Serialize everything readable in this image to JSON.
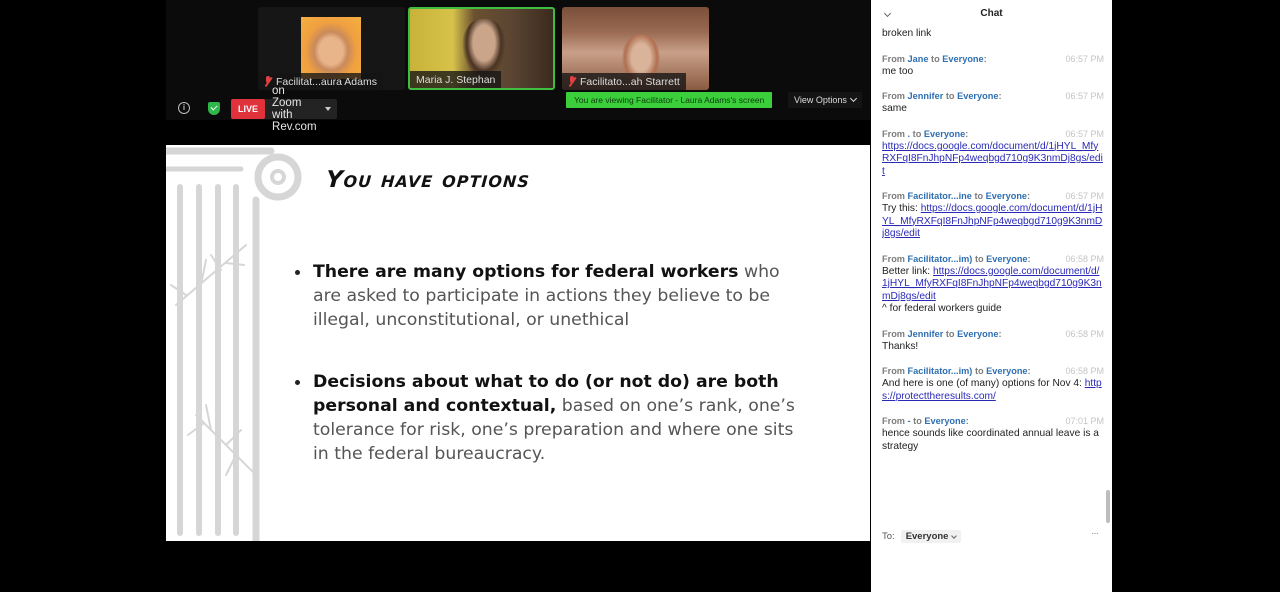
{
  "meeting": {
    "participants": [
      {
        "name": "Facilitat...aura Adams",
        "muted": true,
        "active": false
      },
      {
        "name": "Maria J. Stephan",
        "muted": false,
        "active": true
      },
      {
        "name": "Facilitato...ah Starrett",
        "muted": true,
        "active": false
      }
    ],
    "live": {
      "badge": "LIVE",
      "label": "on Zoom with Rev.com"
    },
    "viewing_banner": "You are viewing Facilitator - Laura Adams's screen",
    "view_options": "View Options",
    "icons": {
      "info": "info-icon",
      "security": "shield-check-icon"
    }
  },
  "slide": {
    "title": "You have options",
    "bullets": [
      {
        "bold": "There are many options for federal workers",
        "normal": " who are asked to participate in actions they believe to be illegal, unconstitutional, or unethical"
      },
      {
        "bold": "Decisions about what to do (or not do) are both personal and contextual,",
        "normal": " based on one’s rank, one’s tolerance for risk, one’s preparation and where one sits in the federal bureaucracy."
      }
    ]
  },
  "chat": {
    "title": "Chat",
    "first_line": "broken link",
    "messages": [
      {
        "from": "Jane",
        "to": "Everyone",
        "time": "06:57 PM",
        "text": "me too",
        "link": ""
      },
      {
        "from": "Jennifer",
        "to": "Everyone",
        "time": "06:57 PM",
        "text": "same",
        "link": ""
      },
      {
        "from": ".",
        "to": "Everyone",
        "time": "06:57 PM",
        "text": "",
        "link": "https://docs.google.com/document/d/1jHYL_MfyRXFqI8FnJhpNFp4weqbgd710g9K3nmDj8gs/edit"
      },
      {
        "from": "Facilitator...ine",
        "to": "Everyone",
        "time": "06:57 PM",
        "text": "Try this: ",
        "link": "https://docs.google.com/document/d/1jHYL_MfyRXFqI8FnJhpNFp4weqbgd710g9K3nmDj8gs/edit"
      },
      {
        "from": "Facilitator...im)",
        "to": "Everyone",
        "time": "06:58 PM",
        "text": "Better link: ",
        "link": "https://docs.google.com/document/d/1jHYL_MfyRXFqI8FnJhpNFp4weqbgd710g9K3nmDj8gs/edit",
        "after": "^ for federal workers guide"
      },
      {
        "from": "Jennifer",
        "to": "Everyone",
        "time": "06:58 PM",
        "text": "Thanks!",
        "link": ""
      },
      {
        "from": "Facilitator...im)",
        "to": "Everyone",
        "time": "06:58 PM",
        "text": "And here is one (of many) options for Nov 4: ",
        "link": "https://protecttheresults.com/"
      },
      {
        "from": "-",
        "to": "Everyone",
        "time": "07:01 PM",
        "text": "hence sounds like coordinated annual leave is a strategy",
        "link": ""
      }
    ],
    "labels": {
      "from": "From",
      "to_word": "to"
    },
    "recipient_label": "To:",
    "recipient_value": "Everyone",
    "more": "···"
  }
}
